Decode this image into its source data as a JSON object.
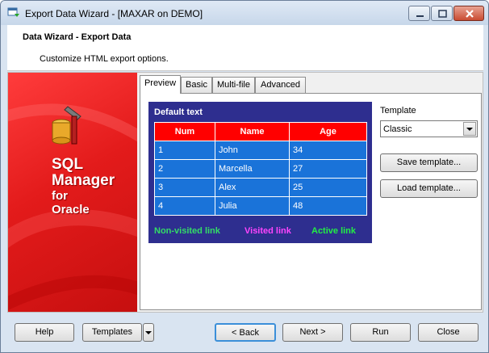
{
  "window": {
    "title": "Export Data Wizard - [MAXAR on DEMO]"
  },
  "header": {
    "title": "Data Wizard - Export Data",
    "subtitle": "Customize HTML export options."
  },
  "banner": {
    "line1": "SQL",
    "line2": "Manager",
    "line3": "for",
    "line4": "Oracle"
  },
  "tabs": [
    {
      "label": "Preview",
      "active": true
    },
    {
      "label": "Basic",
      "active": false
    },
    {
      "label": "Multi-file",
      "active": false
    },
    {
      "label": "Advanced",
      "active": false
    }
  ],
  "preview": {
    "default_text": "Default text",
    "columns": [
      "Num",
      "Name",
      "Age"
    ],
    "rows": [
      [
        "1",
        "John",
        "34"
      ],
      [
        "2",
        "Marcella",
        "27"
      ],
      [
        "3",
        "Alex",
        "25"
      ],
      [
        "4",
        "Julia",
        "48"
      ]
    ],
    "links": {
      "non_visited": "Non-visited link",
      "visited": "Visited link",
      "active": "Active link"
    }
  },
  "template": {
    "label": "Template",
    "selected": "Classic",
    "save_label": "Save template...",
    "load_label": "Load template..."
  },
  "footer": {
    "help": "Help",
    "templates": "Templates",
    "back": "< Back",
    "next": "Next >",
    "run": "Run",
    "close": "Close"
  },
  "colors": {
    "preview_bg": "#2e2e8f",
    "header_cell": "#ff0000",
    "data_cell": "#1a73d9",
    "banner": "#e31b1b"
  }
}
